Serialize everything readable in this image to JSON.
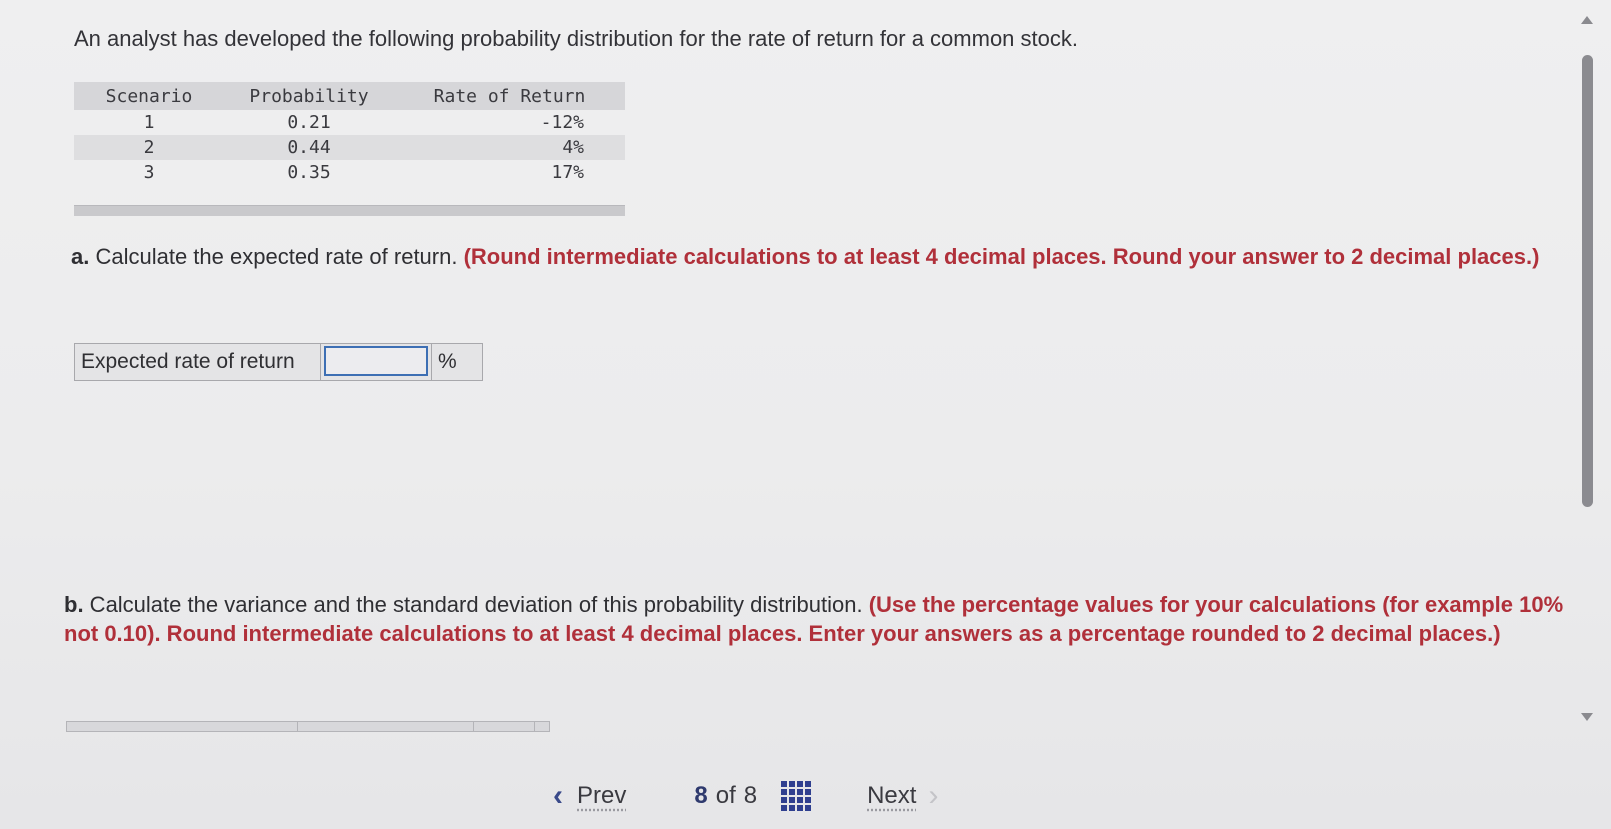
{
  "intro": "An analyst has developed the following probability distribution for the rate of return for a common stock.",
  "table": {
    "headers": [
      "Scenario",
      "Probability",
      "Rate of Return"
    ],
    "rows": [
      [
        "1",
        "0.21",
        "-12%"
      ],
      [
        "2",
        "0.44",
        "4%"
      ],
      [
        "3",
        "0.35",
        "17%"
      ]
    ]
  },
  "part_a": {
    "lead": "a.",
    "text": " Calculate the expected rate of return. ",
    "emphasis": "(Round intermediate calculations to at least 4 decimal places. Round your answer to 2 decimal places.)",
    "answer_label": "Expected rate of return",
    "answer_value": "",
    "answer_unit": "%"
  },
  "part_b": {
    "lead": "b.",
    "text": " Calculate the variance and the standard deviation of this probability distribution. ",
    "emphasis": "(Use the percentage values for your calculations (for example 10% not 0.10). Round intermediate calculations to at least 4 decimal places. Enter your answers as a percentage rounded to 2 decimal places.)"
  },
  "nav": {
    "prev_label": "Prev",
    "current_page": "8",
    "of_label": "of",
    "total_pages": "8",
    "next_label": "Next",
    "prev_icon": "chevron-left-icon",
    "next_icon": "chevron-right-icon",
    "grid_icon": "question-grid-icon"
  },
  "colors": {
    "emphasis": "#b0303a",
    "nav_accent": "#2f3f8f"
  }
}
